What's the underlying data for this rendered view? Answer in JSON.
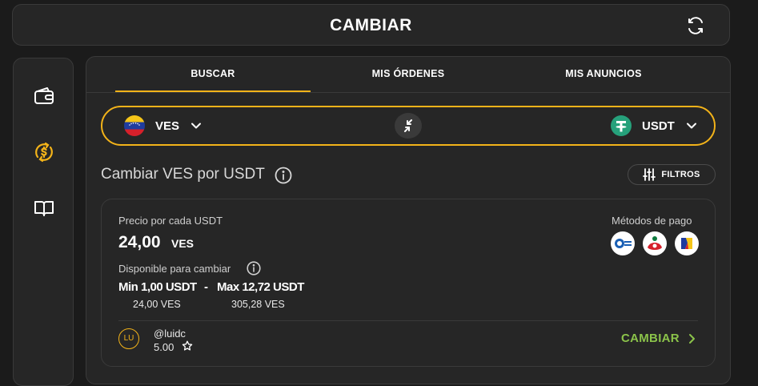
{
  "header": {
    "title": "CAMBIAR",
    "refresh_icon": "refresh-icon"
  },
  "sidebar": {
    "items": [
      {
        "icon": "wallet-icon"
      },
      {
        "icon": "exchange-dollar-icon",
        "active_color": "#f3b319"
      },
      {
        "icon": "book-icon"
      }
    ]
  },
  "tabs": [
    {
      "label": "BUSCAR",
      "active": true
    },
    {
      "label": "MIS ÓRDENES"
    },
    {
      "label": "MIS ANUNCIOS"
    }
  ],
  "pair": {
    "from": {
      "code": "VES",
      "icon": "venezuela-flag-icon"
    },
    "to": {
      "code": "USDT",
      "icon": "tether-icon"
    },
    "swap_icon": "swap-arrows-icon",
    "border_color": "#f3b319"
  },
  "heading": "Cambiar VES por USDT",
  "filters_label": "FILTROS",
  "offer": {
    "price_label": "Precio por cada USDT",
    "price": "24,00",
    "price_unit": "VES",
    "available_label": "Disponible para cambiar",
    "min_label": "Min 1,00 USDT",
    "separator": "-",
    "max_label": "Max 12,72 USDT",
    "min_ves": "24,00 VES",
    "max_ves": "305,28 VES",
    "payment_label": "Métodos de pago",
    "payment_methods": [
      "bank-icon-1",
      "bank-icon-2",
      "bank-icon-3"
    ],
    "user_initials": "LU",
    "username": "@luidc",
    "rating": "5.00",
    "cta_label": "CAMBIAR",
    "cta_color": "#8bc34a"
  }
}
